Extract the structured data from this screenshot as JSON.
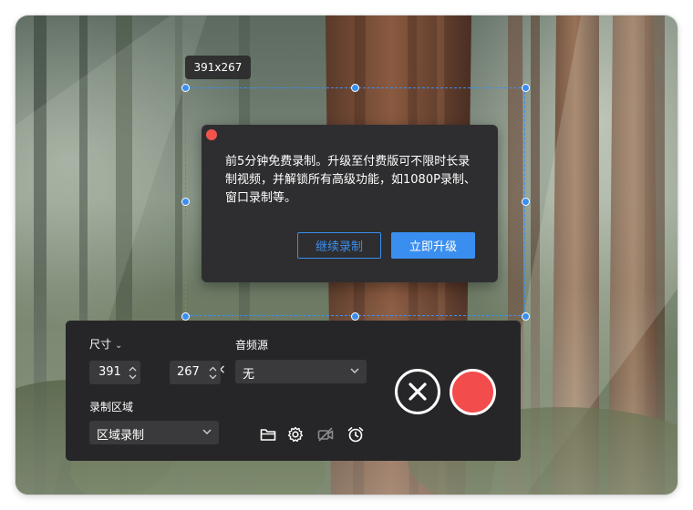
{
  "selection": {
    "size_label": "391x267"
  },
  "dialog": {
    "message": "前5分钟免费录制。升级至付费版可不限时长录制视频，并解锁所有高级功能，如1080P录制、窗口录制等。",
    "continue_label": "继续录制",
    "upgrade_label": "立即升级"
  },
  "panel": {
    "size_label": "尺寸",
    "width_value": "391",
    "height_value": "267",
    "times_symbol": "×",
    "audio_label": "音频源",
    "audio_value": "无",
    "area_label": "录制区域",
    "area_value": "区域录制"
  },
  "icons": {
    "folder": "folder-icon",
    "settings": "gear-icon",
    "camera_off": "camera-off-icon",
    "timer": "alarm-clock-icon",
    "cancel": "close-circle-icon"
  },
  "colors": {
    "accent": "#3a8ef0",
    "record": "#f24c4c",
    "dialog_bg": "#2e2e30",
    "panel_bg": "#262628"
  }
}
